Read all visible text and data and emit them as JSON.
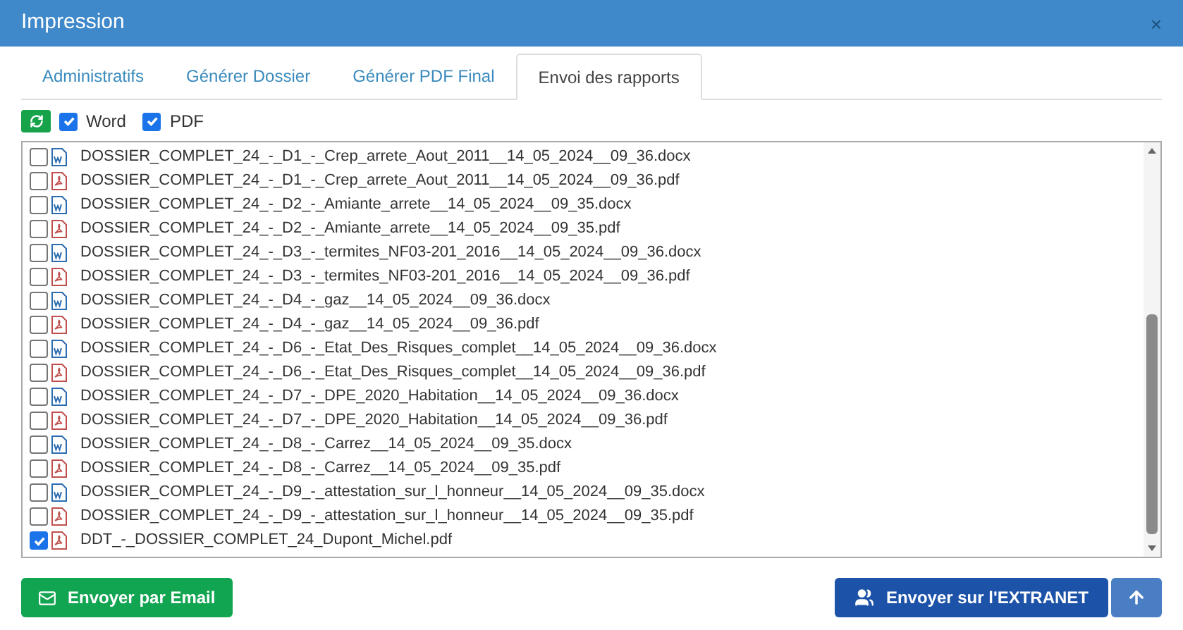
{
  "window": {
    "title": "Impression",
    "close": "×"
  },
  "tabs": [
    {
      "label": "Administratifs",
      "selected": false
    },
    {
      "label": "Générer Dossier",
      "selected": false
    },
    {
      "label": "Générer PDF Final",
      "selected": false
    },
    {
      "label": "Envoi des rapports",
      "selected": true
    }
  ],
  "filters": [
    {
      "label": "Word",
      "checked": true
    },
    {
      "label": "PDF",
      "checked": true
    }
  ],
  "files": [
    {
      "name": "DOSSIER_COMPLET_24_-_D1_-_Crep_arrete_Aout_2011__14_05_2024__09_36.docx",
      "kind": "docx",
      "checked": false
    },
    {
      "name": "DOSSIER_COMPLET_24_-_D1_-_Crep_arrete_Aout_2011__14_05_2024__09_36.pdf",
      "kind": "pdf",
      "checked": false
    },
    {
      "name": "DOSSIER_COMPLET_24_-_D2_-_Amiante_arrete__14_05_2024__09_35.docx",
      "kind": "docx",
      "checked": false
    },
    {
      "name": "DOSSIER_COMPLET_24_-_D2_-_Amiante_arrete__14_05_2024__09_35.pdf",
      "kind": "pdf",
      "checked": false
    },
    {
      "name": "DOSSIER_COMPLET_24_-_D3_-_termites_NF03-201_2016__14_05_2024__09_36.docx",
      "kind": "docx",
      "checked": false
    },
    {
      "name": "DOSSIER_COMPLET_24_-_D3_-_termites_NF03-201_2016__14_05_2024__09_36.pdf",
      "kind": "pdf",
      "checked": false
    },
    {
      "name": "DOSSIER_COMPLET_24_-_D4_-_gaz__14_05_2024__09_36.docx",
      "kind": "docx",
      "checked": false
    },
    {
      "name": "DOSSIER_COMPLET_24_-_D4_-_gaz__14_05_2024__09_36.pdf",
      "kind": "pdf",
      "checked": false
    },
    {
      "name": "DOSSIER_COMPLET_24_-_D6_-_Etat_Des_Risques_complet__14_05_2024__09_36.docx",
      "kind": "docx",
      "checked": false
    },
    {
      "name": "DOSSIER_COMPLET_24_-_D6_-_Etat_Des_Risques_complet__14_05_2024__09_36.pdf",
      "kind": "pdf",
      "checked": false
    },
    {
      "name": "DOSSIER_COMPLET_24_-_D7_-_DPE_2020_Habitation__14_05_2024__09_36.docx",
      "kind": "docx",
      "checked": false
    },
    {
      "name": "DOSSIER_COMPLET_24_-_D7_-_DPE_2020_Habitation__14_05_2024__09_36.pdf",
      "kind": "pdf",
      "checked": false
    },
    {
      "name": "DOSSIER_COMPLET_24_-_D8_-_Carrez__14_05_2024__09_35.docx",
      "kind": "docx",
      "checked": false
    },
    {
      "name": "DOSSIER_COMPLET_24_-_D8_-_Carrez__14_05_2024__09_35.pdf",
      "kind": "pdf",
      "checked": false
    },
    {
      "name": "DOSSIER_COMPLET_24_-_D9_-_attestation_sur_l_honneur__14_05_2024__09_35.docx",
      "kind": "docx",
      "checked": false
    },
    {
      "name": "DOSSIER_COMPLET_24_-_D9_-_attestation_sur_l_honneur__14_05_2024__09_35.pdf",
      "kind": "pdf",
      "checked": false
    },
    {
      "name": "DDT_-_DOSSIER_COMPLET_24_Dupont_Michel.pdf",
      "kind": "pdf",
      "checked": true
    }
  ],
  "buttons": {
    "email": "Envoyer par Email",
    "extranet": "Envoyer sur l'EXTRANET"
  }
}
